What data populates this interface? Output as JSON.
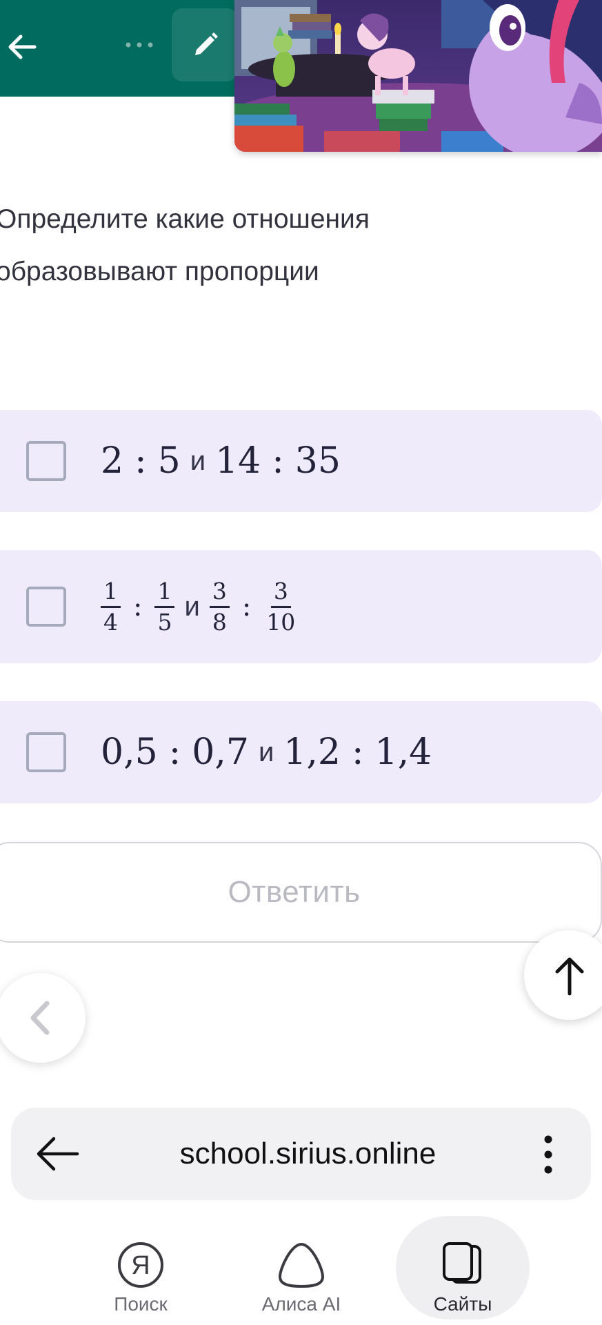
{
  "question": {
    "line1": "Определите какие отношения",
    "line2": "образовывают пропорции"
  },
  "options": [
    {
      "a": "2",
      "b": "5",
      "connector": "и",
      "c": "14",
      "d": "35",
      "checked": false
    },
    {
      "a_num": "1",
      "a_den": "4",
      "b_num": "1",
      "b_den": "5",
      "connector": "и",
      "c_num": "3",
      "c_den": "8",
      "d_num": "3",
      "d_den": "10",
      "checked": false
    },
    {
      "a": "0,5",
      "b": "0,7",
      "connector": "и",
      "c": "1,2",
      "d": "1,4",
      "checked": false
    }
  ],
  "ratio_sign": ":",
  "answer_button": "Ответить",
  "browser": {
    "url": "school.sirius.online"
  },
  "bottom_nav": {
    "search": "Поиск",
    "alice": "Алиса AI",
    "sites": "Сайты",
    "search_glyph": "Я"
  },
  "icons": {
    "back": "arrow-left-icon",
    "more": "more-horizontal-icon",
    "edit": "pencil-icon",
    "prev": "chevron-left-icon",
    "up": "arrow-up-icon",
    "menu": "more-vertical-icon"
  },
  "colors": {
    "header": "#006b5e",
    "option_bg": "#efebfa",
    "button_text_disabled": "#b9b9c2"
  }
}
